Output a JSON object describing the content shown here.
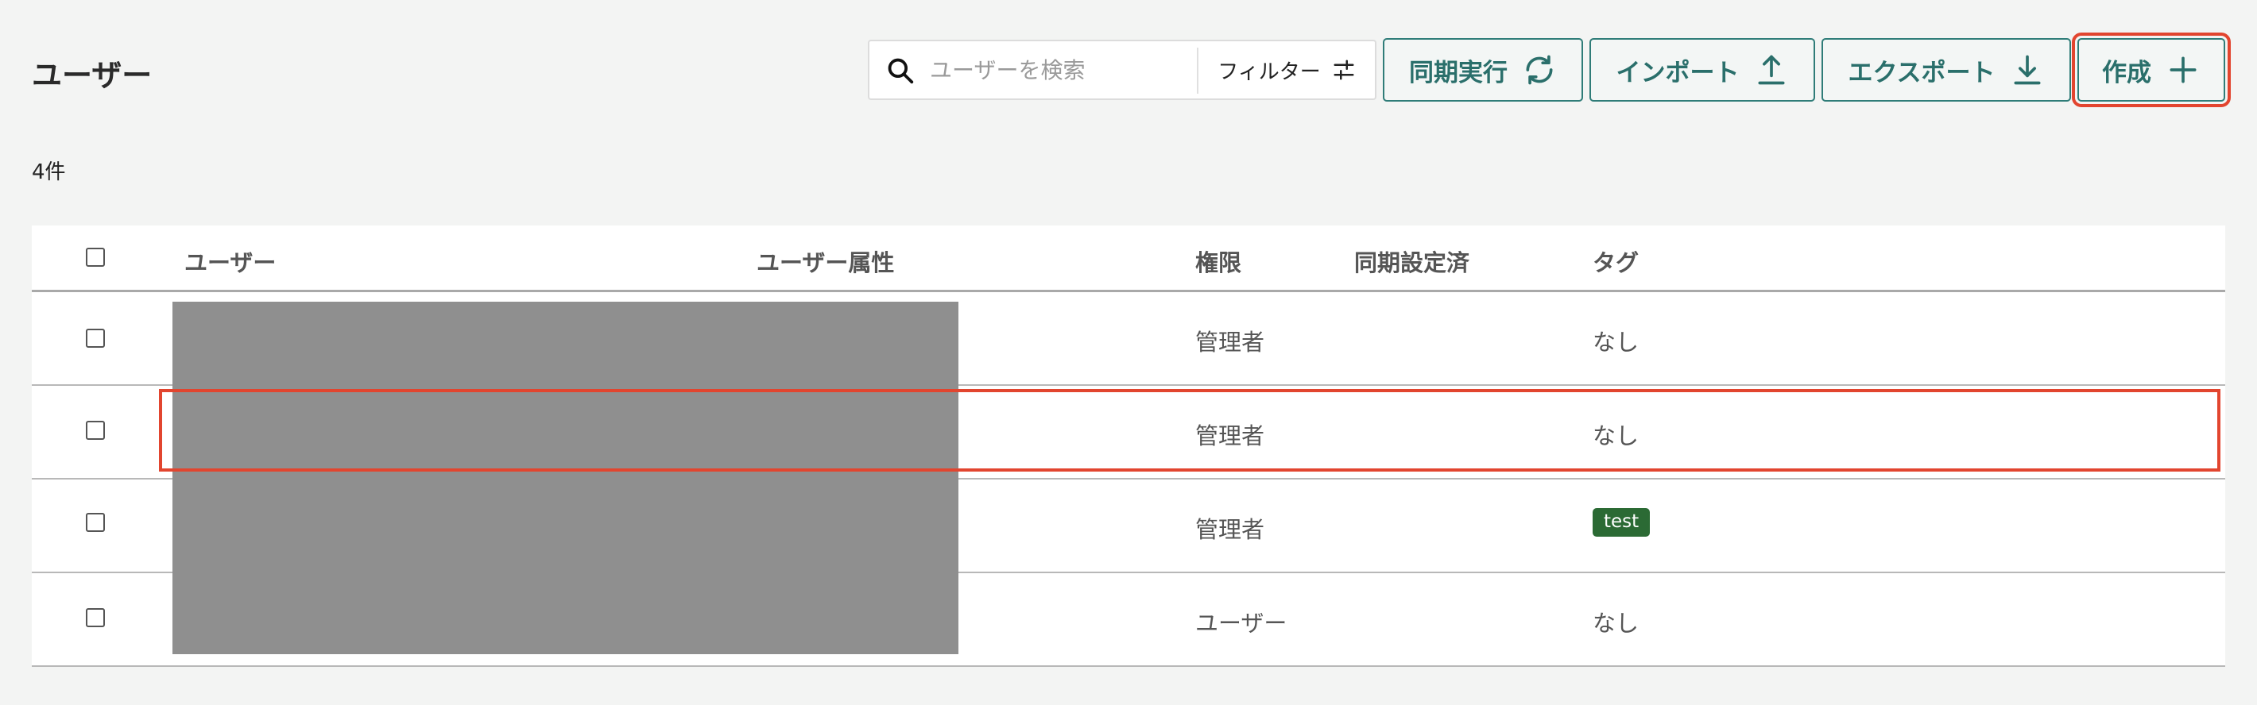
{
  "page": {
    "title": "ユーザー",
    "count": "4件"
  },
  "search": {
    "placeholder": "ユーザーを検索",
    "value": ""
  },
  "toolbar": {
    "filter_label": "フィルター",
    "sync_label": "同期実行",
    "import_label": "インポート",
    "export_label": "エクスポート",
    "create_label": "作成"
  },
  "table": {
    "columns": [
      "ユーザー",
      "ユーザー属性",
      "権限",
      "同期設定済",
      "タグ"
    ],
    "rows": [
      {
        "role": "管理者",
        "synced": "",
        "tag": "なし"
      },
      {
        "role": "管理者",
        "synced": "",
        "tag": "なし"
      },
      {
        "role": "管理者",
        "synced": "",
        "tag": "test"
      },
      {
        "role": "ユーザー",
        "synced": "",
        "tag": "なし"
      }
    ]
  },
  "colors": {
    "accent": "#2f7c78",
    "highlight": "#e2452f",
    "tag_bg": "#2b6a34",
    "redaction": "#8f8f8f"
  },
  "icons": [
    "search-icon",
    "filter-sliders-icon",
    "sync-icon",
    "upload-icon",
    "download-icon",
    "plus-icon"
  ]
}
